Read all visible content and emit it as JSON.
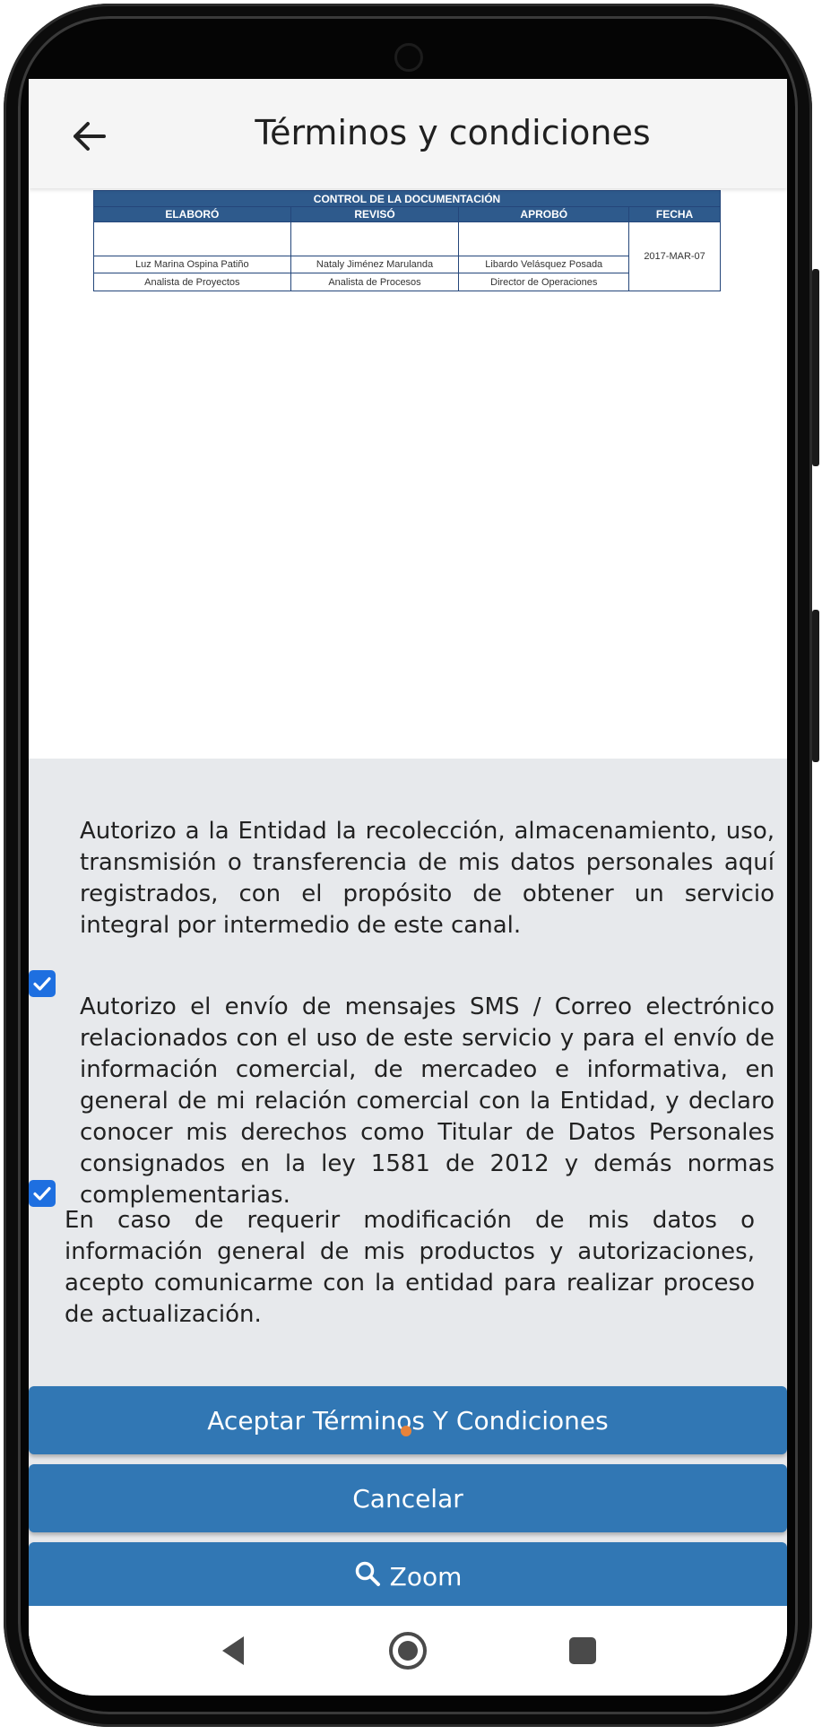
{
  "appbar": {
    "title": "Términos y condiciones",
    "back_icon": "arrow-left-icon"
  },
  "document": {
    "table_title": "CONTROL DE LA DOCUMENTACIÓN",
    "headers": [
      "ELABORÓ",
      "REVISÓ",
      "APROBÓ",
      "FECHA"
    ],
    "names": [
      "Luz Marina Ospina Patiño",
      "Nataly Jiménez Marulanda",
      "Libardo Velásquez Posada"
    ],
    "roles": [
      "Analista de Proyectos",
      "Analista de Procesos",
      "Director de Operaciones"
    ],
    "date": "2017-MAR-07"
  },
  "consent": {
    "checkbox1_checked": true,
    "checkbox1_text": "Autorizo a la Entidad la recolección, almacenamiento, uso, transmisión o transferencia de mis datos personales aquí registrados, con el propósito de obtener un servicio integral por intermedio de este canal.",
    "checkbox2_checked": true,
    "checkbox2_text": "Autorizo el envío de mensajes SMS / Correo electrónico relacionados con el uso de este servicio y para el envío de información comercial, de mercadeo e informativa, en general de mi relación comercial con la Entidad, y declaro conocer mis derechos como Titular de Datos Personales consignados en la ley 1581 de 2012 y demás normas complementarias.",
    "note_text": "En caso de requerir modificación de mis datos o información general de mis productos y autorizaciones, acepto comunicarme con la entidad para realizar proceso de actualización."
  },
  "buttons": {
    "accept_label": "Aceptar Términos Y Condiciones",
    "cancel_label": "Cancelar",
    "zoom_label": "Zoom",
    "zoom_icon": "search-icon"
  },
  "colors": {
    "button_bg": "#3177b4",
    "panel_bg": "#e7e9ec",
    "checkbox": "#1e6fe0",
    "table_header": "#2e5a8c"
  },
  "navbar": {
    "back_icon": "triangle-back-icon",
    "home_icon": "circle-home-icon",
    "recents_icon": "square-recents-icon"
  }
}
